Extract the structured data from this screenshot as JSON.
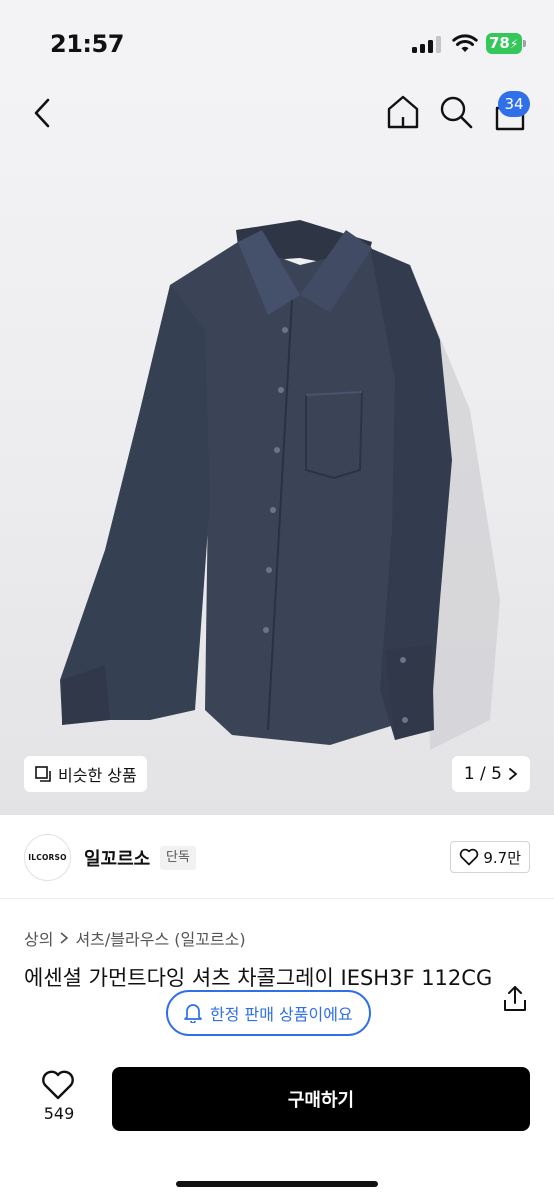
{
  "status_bar": {
    "time": "21:57",
    "battery": "78"
  },
  "nav": {
    "cart_count": "34"
  },
  "gallery": {
    "similar_label": "비슷한 상품",
    "pager": "1 / 5"
  },
  "brand": {
    "logo_text": "ILCORSO",
    "name": "일꼬르소",
    "tag": "단독",
    "likes": "9.7만"
  },
  "breadcrumb": {
    "category": "상의",
    "subcategory": "셔츠/블라우스 (일꼬르소)"
  },
  "product": {
    "title": "에센셜 가먼트다잉 셔츠 차콜그레이 IESH3F 112CG"
  },
  "toast": {
    "text": "한정 판매 상품이에요"
  },
  "bottom": {
    "like_count": "549",
    "buy_label": "구매하기"
  },
  "colors": {
    "accent": "#2f6fe8",
    "shirt": "#3c4558",
    "battery": "#34c759"
  }
}
